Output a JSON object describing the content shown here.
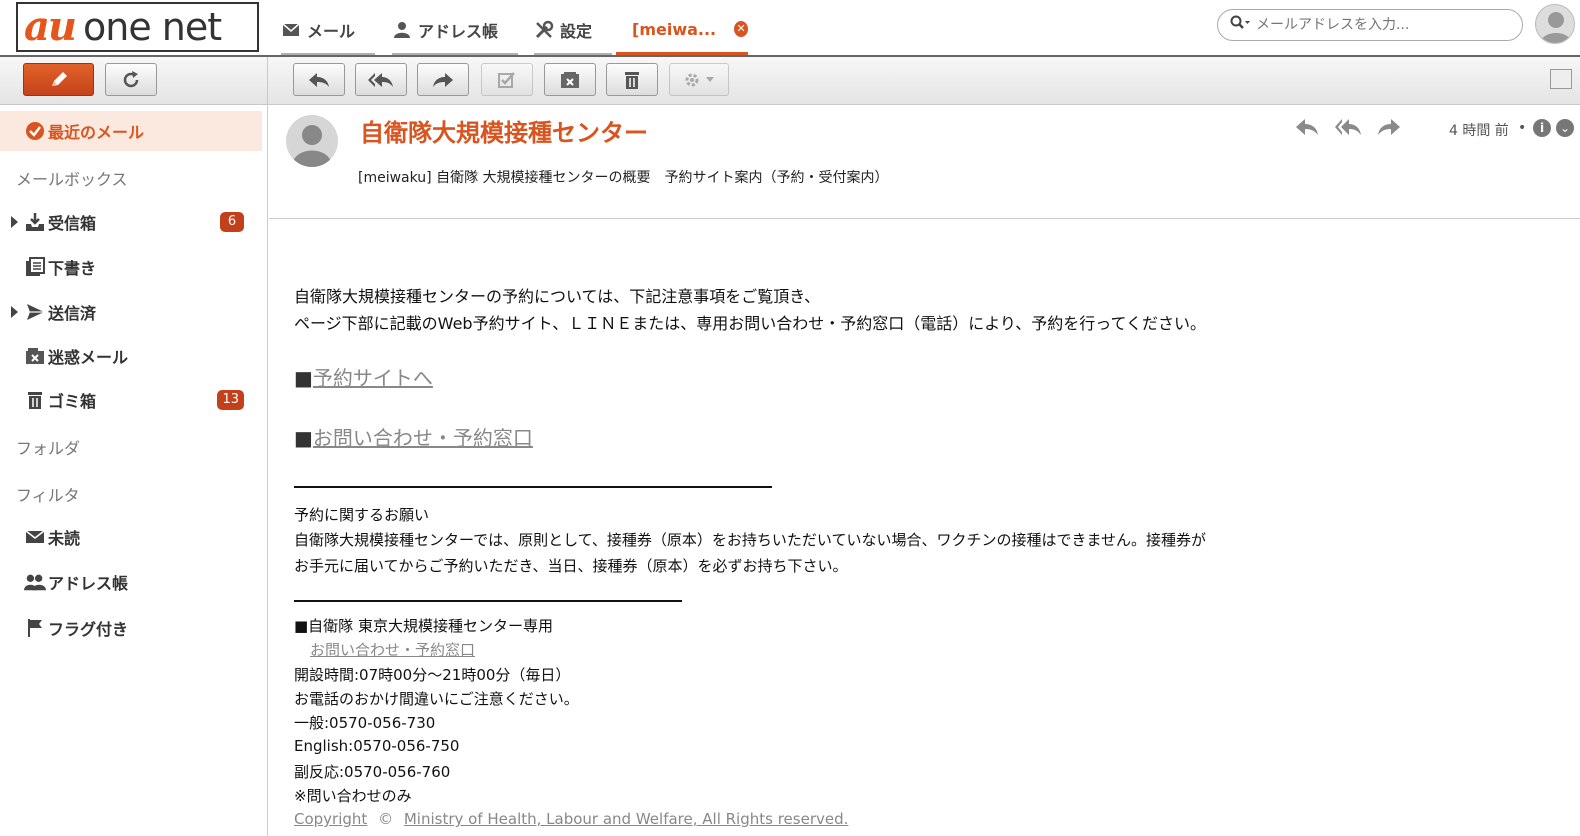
{
  "header": {
    "logo_au": "au",
    "logo_net": "one net",
    "tabs": [
      {
        "label": "メール"
      },
      {
        "label": "アドレス帳"
      },
      {
        "label": "設定"
      },
      {
        "label": "[meiwa..."
      }
    ],
    "search_placeholder": "メールアドレスを入力..."
  },
  "sidebar": {
    "recent": "最近のメール",
    "mailbox_heading": "メールボックス",
    "inbox": "受信箱",
    "inbox_count": "6",
    "drafts": "下書き",
    "sent": "送信済",
    "spam": "迷惑メール",
    "trash": "ゴミ箱",
    "trash_count": "13",
    "folder_heading": "フォルダ",
    "filter_heading": "フィルタ",
    "unread": "未読",
    "address_book": "アドレス帳",
    "flagged": "フラグ付き"
  },
  "message": {
    "subject": "自衛隊大規模接種センター",
    "preview": "[meiwaku] 自衛隊 大規模接種センターの概要　予約サイト案内（予約・受付案内）",
    "time": "4 時間 前",
    "info": "i"
  },
  "body": {
    "intro1": "自衛隊大規模接種センターの予約については、下記注意事項をご覧頂き、",
    "intro2": "ページ下部に記載のWeb予約サイト、ＬＩＮＥまたは、専用お問い合わせ・予約窓口（電話）により、予約を行ってください。",
    "link1_mark": "■",
    "link1": "予約サイトへ",
    "link2_mark": "■",
    "link2": "お問い合わせ・予約窓口",
    "request_title": "予約に関するお願い",
    "request1": "自衛隊大規模接種センターでは、原則として、接種券（原本）をお持ちいただいていない場合、ワクチンの接種はできません。接種券が",
    "request2": "お手元に届いてからご予約いただき、当日、接種券（原本）を必ずお持ち下さい。",
    "tokyo_title": "■自衛隊 東京大規模接種センター専用",
    "tokyo_link": "お問い合わせ・予約窓口",
    "hours": "開設時間:07時00分～21時00分（毎日）",
    "caution": "お電話のおかけ間違いにご注意ください。",
    "general": "一般:0570-056-730",
    "english": "English:0570-056-750",
    "side_effect": "副反応:0570-056-760",
    "note": "※問い合わせのみ",
    "copyright": "Copyright",
    "copyright_sym": "©",
    "ministry": "Ministry of Health, Labour and Welfare, All Rights reserved."
  }
}
